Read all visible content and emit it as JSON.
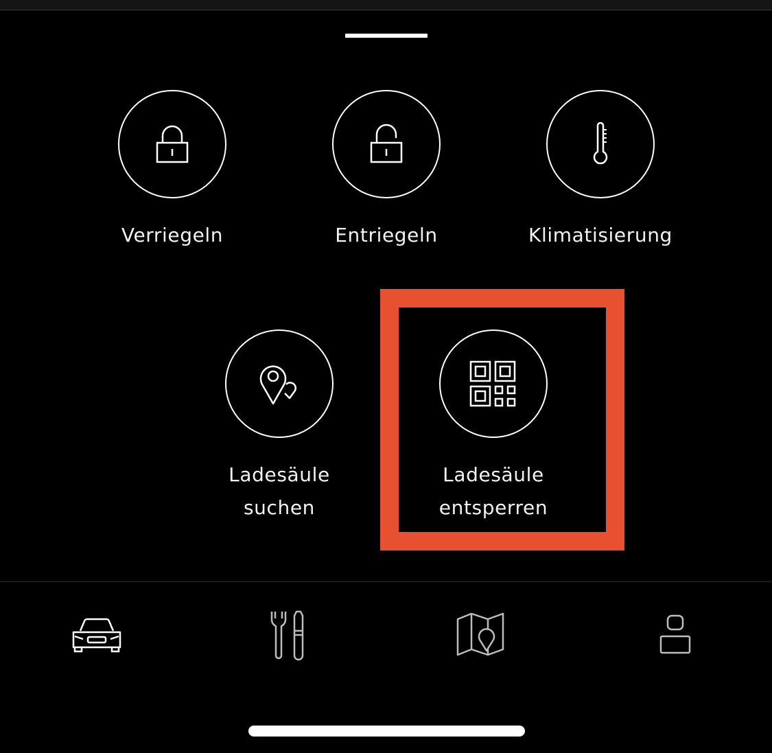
{
  "actions": [
    {
      "id": "lock",
      "label": "Verriegeln",
      "icon": "lock-closed-icon"
    },
    {
      "id": "unlock",
      "label": "Entriegeln",
      "icon": "lock-open-icon"
    },
    {
      "id": "climate",
      "label": "Klimatisierung",
      "icon": "thermometer-icon"
    },
    {
      "id": "find-charger",
      "label": "Ladesäule\nsuchen",
      "icon": "location-pin-icon"
    },
    {
      "id": "unlock-charger",
      "label": "Ladesäule\nentsperren",
      "icon": "qr-code-icon"
    }
  ],
  "tabs": [
    {
      "id": "vehicle",
      "icon": "car-icon",
      "active": true
    },
    {
      "id": "service",
      "icon": "tools-icon",
      "active": false
    },
    {
      "id": "map",
      "icon": "map-icon",
      "active": false
    },
    {
      "id": "profile",
      "icon": "profile-icon",
      "active": false
    }
  ],
  "colors": {
    "background": "#000000",
    "foreground": "#ffffff",
    "highlight": "#e8512f",
    "inactive_tab": "#bdbdbd"
  }
}
